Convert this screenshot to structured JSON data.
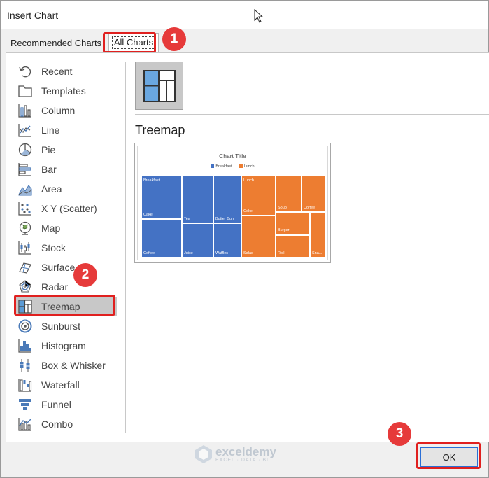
{
  "window": {
    "title": "Insert Chart"
  },
  "tabs": [
    {
      "label": "Recommended Charts"
    },
    {
      "label": "All Charts"
    }
  ],
  "categories": [
    {
      "label": "Recent",
      "icon": "recent-icon"
    },
    {
      "label": "Templates",
      "icon": "templates-icon"
    },
    {
      "label": "Column",
      "icon": "column-chart-icon"
    },
    {
      "label": "Line",
      "icon": "line-chart-icon"
    },
    {
      "label": "Pie",
      "icon": "pie-chart-icon"
    },
    {
      "label": "Bar",
      "icon": "bar-chart-icon"
    },
    {
      "label": "Area",
      "icon": "area-chart-icon"
    },
    {
      "label": "X Y (Scatter)",
      "icon": "scatter-chart-icon"
    },
    {
      "label": "Map",
      "icon": "map-chart-icon"
    },
    {
      "label": "Stock",
      "icon": "stock-chart-icon"
    },
    {
      "label": "Surface",
      "icon": "surface-chart-icon"
    },
    {
      "label": "Radar",
      "icon": "radar-chart-icon"
    },
    {
      "label": "Treemap",
      "icon": "treemap-chart-icon"
    },
    {
      "label": "Sunburst",
      "icon": "sunburst-chart-icon"
    },
    {
      "label": "Histogram",
      "icon": "histogram-chart-icon"
    },
    {
      "label": "Box & Whisker",
      "icon": "box-whisker-chart-icon"
    },
    {
      "label": "Waterfall",
      "icon": "waterfall-chart-icon"
    },
    {
      "label": "Funnel",
      "icon": "funnel-chart-icon"
    },
    {
      "label": "Combo",
      "icon": "combo-chart-icon"
    }
  ],
  "selected_category": "Treemap",
  "main": {
    "chart_name": "Treemap"
  },
  "preview": {
    "title": "Chart Title",
    "legend": [
      {
        "name": "Breakfast",
        "color": "#4472c4"
      },
      {
        "name": "Lunch",
        "color": "#ed7d31"
      }
    ],
    "tiles": {
      "breakfast": "Breakfast",
      "cake": "Cake",
      "coffee": "Coffee",
      "tea": "Tea",
      "juice": "Juice",
      "butter_bun": "Butter Bun",
      "waffles": "Waffles",
      "lunch": "Lunch",
      "coke": "Coke",
      "salad": "Salad",
      "soup": "Soup",
      "coffee2": "Coffee",
      "burger": "Burger",
      "roll": "Roll",
      "sna": "Sna..."
    }
  },
  "footer": {
    "ok_label": "OK"
  },
  "annotations": {
    "step1": "1",
    "step2": "2",
    "step3": "3"
  },
  "watermark": {
    "name": "exceldemy",
    "tagline": "EXCEL · DATA · BI"
  },
  "colors": {
    "highlight": "#e0201f",
    "badge": "#e63a3a",
    "accent": "#2a6fd6"
  }
}
